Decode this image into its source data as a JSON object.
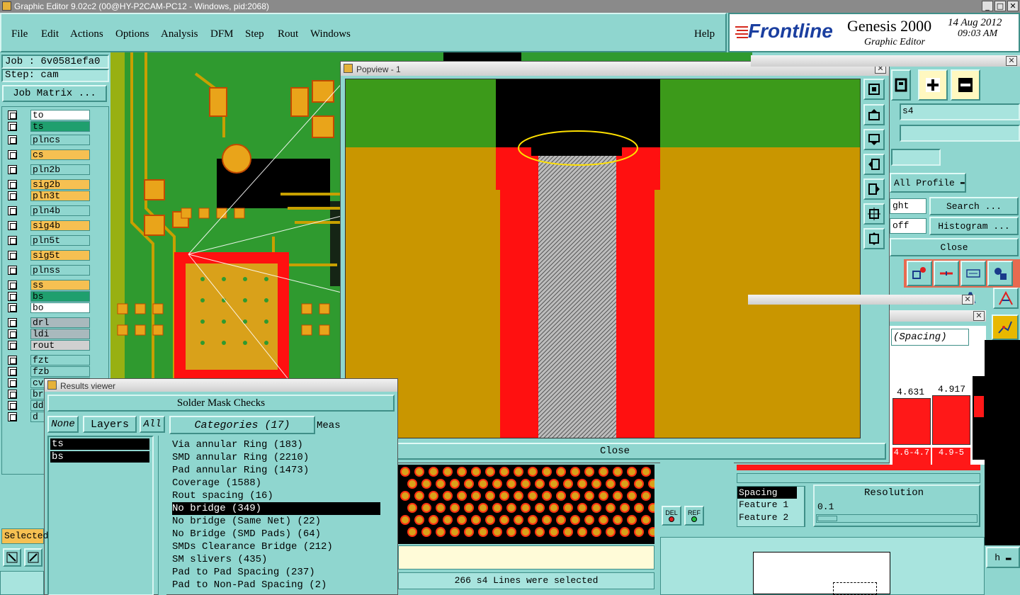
{
  "window": {
    "title": "Graphic Editor 9.02c2 (00@HY-P2CAM-PC12 - Windows, pid:2068)",
    "min": "_",
    "max": "□",
    "close": "✕"
  },
  "menu": {
    "file": "File",
    "edit": "Edit",
    "actions": "Actions",
    "options": "Options",
    "analysis": "Analysis",
    "dfm": "DFM",
    "step": "Step",
    "rout": "Rout",
    "windows": "Windows",
    "help": "Help"
  },
  "logo": {
    "brand": "Frontline",
    "product": "Genesis 2000",
    "subtitle": "Graphic Editor",
    "date": "14 Aug 2012",
    "time": "09:03 AM"
  },
  "job": {
    "job": "Job : 6v0581efa0",
    "step": "Step: cam",
    "matrix": "Job Matrix ...",
    "selected": "Selected"
  },
  "layers": [
    {
      "name": "to",
      "bg": "#ffffff"
    },
    {
      "name": "ts",
      "bg": "#1f9f6e"
    },
    {
      "name": "plncs",
      "bg": "#8fd6cf"
    },
    {
      "name": "cs",
      "bg": "#f6c052"
    },
    {
      "name": "pln2b",
      "bg": "#8fd6cf"
    },
    {
      "name": "sig2b",
      "bg": "#f6c052"
    },
    {
      "name": "pln3t",
      "bg": "#f6c052"
    },
    {
      "name": "pln4b",
      "bg": "#8fd6cf"
    },
    {
      "name": "sig4b",
      "bg": "#f6c052"
    },
    {
      "name": "pln5t",
      "bg": "#8fd6cf"
    },
    {
      "name": "sig5t",
      "bg": "#f6c052"
    },
    {
      "name": "plnss",
      "bg": "#8fd6cf"
    },
    {
      "name": "ss",
      "bg": "#f6c052"
    },
    {
      "name": "bs",
      "bg": "#1f9f6e"
    },
    {
      "name": "bo",
      "bg": "#ffffff"
    },
    {
      "name": "drl",
      "bg": "#a9b9bd"
    },
    {
      "name": "ldi",
      "bg": "#a9b9bd"
    },
    {
      "name": "rout",
      "bg": "#d0d0d0"
    },
    {
      "name": "fzt",
      "bg": "#8fd6cf"
    },
    {
      "name": "fzb",
      "bg": "#8fd6cf"
    },
    {
      "name": "cvi",
      "bg": "#8fd6cf"
    },
    {
      "name": "brc",
      "bg": "#8fd6cf"
    },
    {
      "name": "dd",
      "bg": "#8fd6cf"
    },
    {
      "name": "d",
      "bg": "#8fd6cf"
    }
  ],
  "popview": {
    "title": "Popview - 1",
    "close": "Close"
  },
  "results": {
    "title": "Results viewer",
    "header": "Solder Mask Checks",
    "none": "None",
    "layers": "Layers",
    "all": "All",
    "categories": "Categories (17)",
    "meas": "Meas",
    "layer_list": [
      "ts",
      "bs"
    ],
    "items": [
      "Via annular Ring (183)",
      "SMD annular Ring (2210)",
      "Pad annular Ring (1473)",
      "Coverage (1588)",
      "Rout spacing (16)",
      "No bridge (349)",
      "No bridge (Same Net) (22)",
      "No Bridge (SMD Pads) (64)",
      "SMDs Clearance Bridge (212)",
      "SM slivers (435)",
      "Pad to Pad Spacing (237)",
      "Pad to Non-Pad Spacing (2)"
    ],
    "selected_index": 5
  },
  "status": {
    "selected_msg": "266 s4 Lines were selected"
  },
  "right": {
    "layer_field": "s4",
    "profile": "All Profile",
    "ght": "ght",
    "off": "off",
    "search": "Search ...",
    "histogram": "Histogram ...",
    "close": "Close",
    "spacing_title": "(Spacing)",
    "bar1_value": "4.631",
    "bar2_value": "4.917",
    "bar1_range": "4.6-4.7",
    "bar2_range": "4.9-5",
    "spacing": "Spacing",
    "feature1": "Feature 1",
    "feature2": "Feature 2",
    "resolution": "Resolution",
    "resolution_value": "0.1",
    "del": "DEL",
    "ref": "REF"
  }
}
